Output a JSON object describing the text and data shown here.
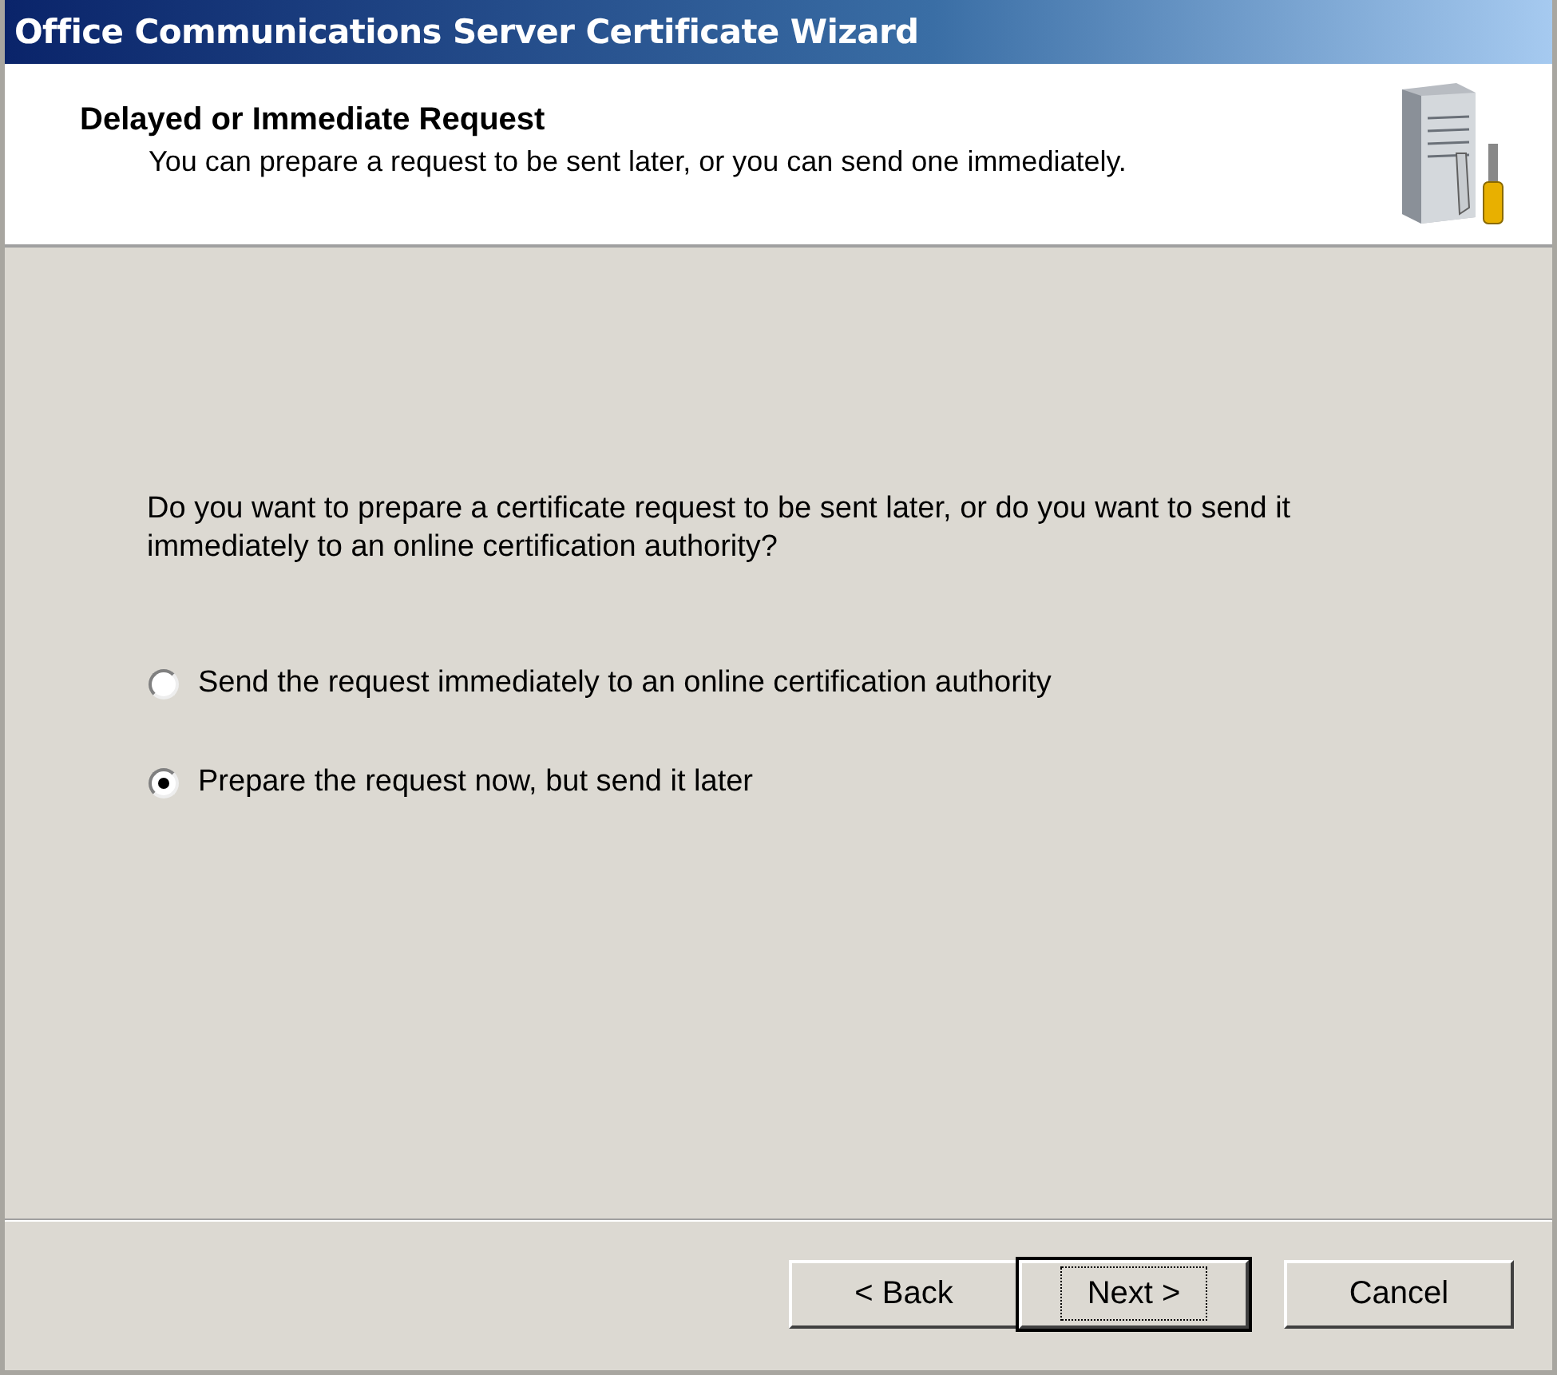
{
  "window": {
    "title": "Office Communications Server Certificate Wizard"
  },
  "header": {
    "title": "Delayed or Immediate Request",
    "subtitle": "You can prepare a request to be sent later, or you can send one immediately."
  },
  "question": "Do you want to prepare a certificate request to be sent later, or do you want to send it immediately to an online certification authority?",
  "options": [
    {
      "label": "Send the request immediately to an online certification authority",
      "selected": false
    },
    {
      "label": "Prepare the request now, but send it later",
      "selected": true
    }
  ],
  "buttons": [
    {
      "label": "< Back",
      "default": false
    },
    {
      "label": "Next >",
      "default": true
    },
    {
      "label": "Cancel",
      "default": false
    }
  ]
}
